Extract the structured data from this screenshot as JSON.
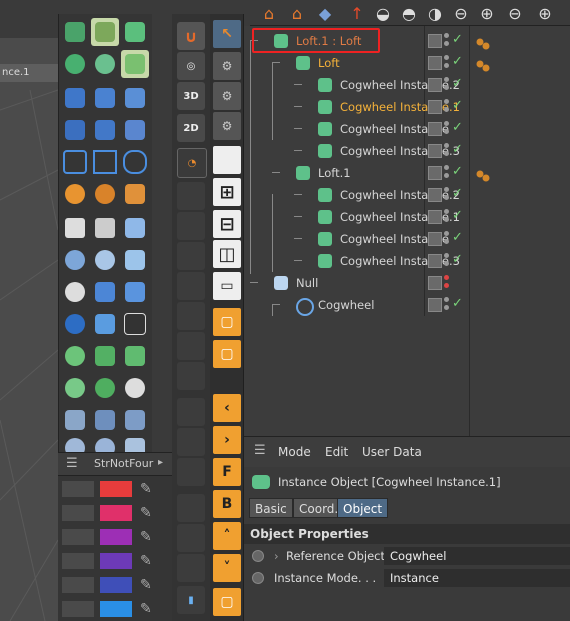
{
  "viewport": {
    "tab_label": "nce.1"
  },
  "layer_browser": {
    "title": "StrNotFour",
    "colors": [
      "#e83c3c",
      "#e0306a",
      "#9d2fb5",
      "#6d3ab8",
      "#3f4fb8",
      "#2a8fe6"
    ]
  },
  "toolbar2": {
    "labels": [
      "3D",
      "2D"
    ]
  },
  "toolbar3": {
    "letters": [
      "F",
      "B"
    ]
  },
  "object_manager": {
    "rows": [
      {
        "label": "Loft.1 : Loft",
        "indent": 0,
        "style": "red",
        "icon": "loft-icon"
      },
      {
        "label": "Loft",
        "indent": 1,
        "style": "hl",
        "icon": "loft-icon"
      },
      {
        "label": "Cogwheel Instance.2",
        "indent": 2,
        "style": "",
        "icon": "instance-icon"
      },
      {
        "label": "Cogwheel Instance.1",
        "indent": 2,
        "style": "hl",
        "icon": "instance-icon"
      },
      {
        "label": "Cogwheel Instance",
        "indent": 2,
        "style": "",
        "icon": "instance-icon"
      },
      {
        "label": "Cogwheel Instance.3",
        "indent": 2,
        "style": "",
        "icon": "instance-icon"
      },
      {
        "label": "Loft.1",
        "indent": 1,
        "style": "",
        "icon": "loft-icon"
      },
      {
        "label": "Cogwheel Instance.2",
        "indent": 2,
        "style": "",
        "icon": "instance-icon"
      },
      {
        "label": "Cogwheel Instance.1",
        "indent": 2,
        "style": "",
        "icon": "instance-icon"
      },
      {
        "label": "Cogwheel Instance",
        "indent": 2,
        "style": "",
        "icon": "instance-icon"
      },
      {
        "label": "Cogwheel Instance.3",
        "indent": 2,
        "style": "",
        "icon": "instance-icon"
      },
      {
        "label": "Null",
        "indent": 0,
        "style": "",
        "icon": "null-icon"
      },
      {
        "label": "Cogwheel",
        "indent": 1,
        "style": "",
        "icon": "cogwheel-icon"
      }
    ]
  },
  "attributes": {
    "menu": [
      "Mode",
      "Edit",
      "User Data"
    ],
    "title": "Instance Object [Cogwheel Instance.1]",
    "tabs": [
      "Basic",
      "Coord.",
      "Object"
    ],
    "active_tab": "Object",
    "section": "Object Properties",
    "properties": [
      {
        "label": "Reference Object",
        "value": "Cogwheel"
      },
      {
        "label": "Instance Mode. . .",
        "value": "Instance"
      }
    ]
  }
}
